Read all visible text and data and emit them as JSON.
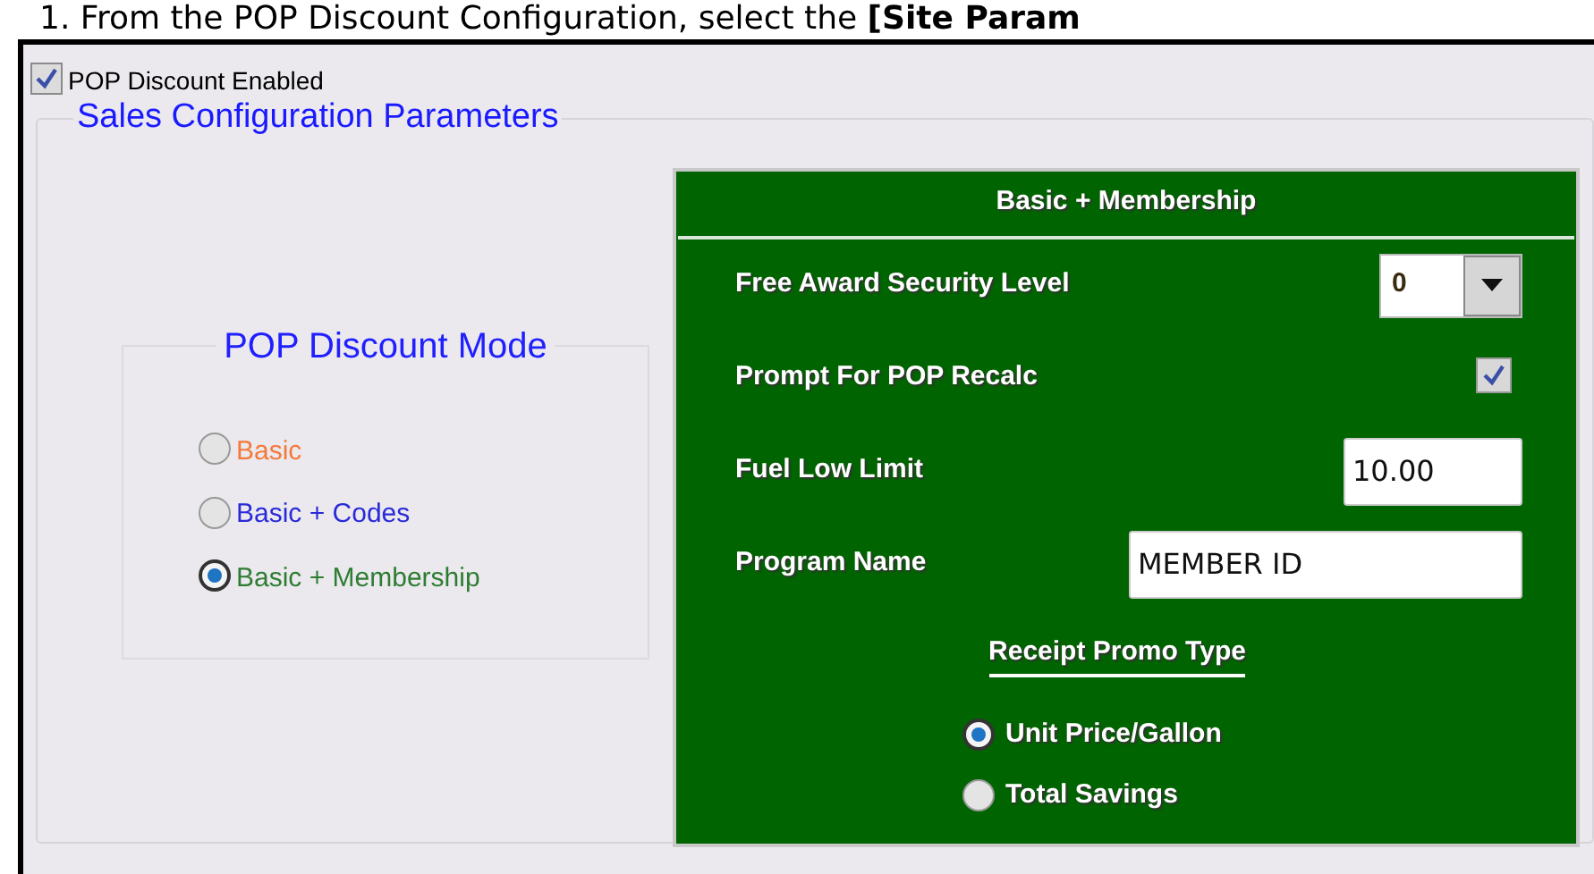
{
  "instruction": {
    "text": "1.  From the POP Discount Configuration, select the **[Site Param**"
  },
  "pop_discount_enabled": {
    "label": "POP Discount Enabled",
    "checked": true
  },
  "sales_configuration_parameters": {
    "title": "Sales Configuration Parameters"
  },
  "pop_discount_mode": {
    "title": "POP Discount Mode",
    "options": [
      {
        "label": "Basic",
        "selected": false,
        "color": "#f4793b"
      },
      {
        "label": "Basic + Codes",
        "selected": false,
        "color": "#2a2ad8"
      },
      {
        "label": "Basic + Membership",
        "selected": true,
        "color": "#2e7d32"
      }
    ]
  },
  "mode_panel": {
    "title": "Basic + Membership",
    "fields": [
      {
        "kind": "dropdown",
        "label": "Free Award Security Level",
        "value": "0"
      },
      {
        "kind": "checkbox",
        "label": "Prompt For POP Recalc",
        "checked": true
      },
      {
        "kind": "number",
        "label": "Fuel Low Limit",
        "value": "10.00"
      },
      {
        "kind": "text",
        "label": "Program Name",
        "value": "MEMBER ID"
      }
    ],
    "receipt_promo_type": {
      "title": "Receipt Promo Type",
      "options": [
        {
          "label": "Unit Price/Gallon",
          "selected": true
        },
        {
          "label": "Total Savings",
          "selected": false
        }
      ]
    }
  }
}
